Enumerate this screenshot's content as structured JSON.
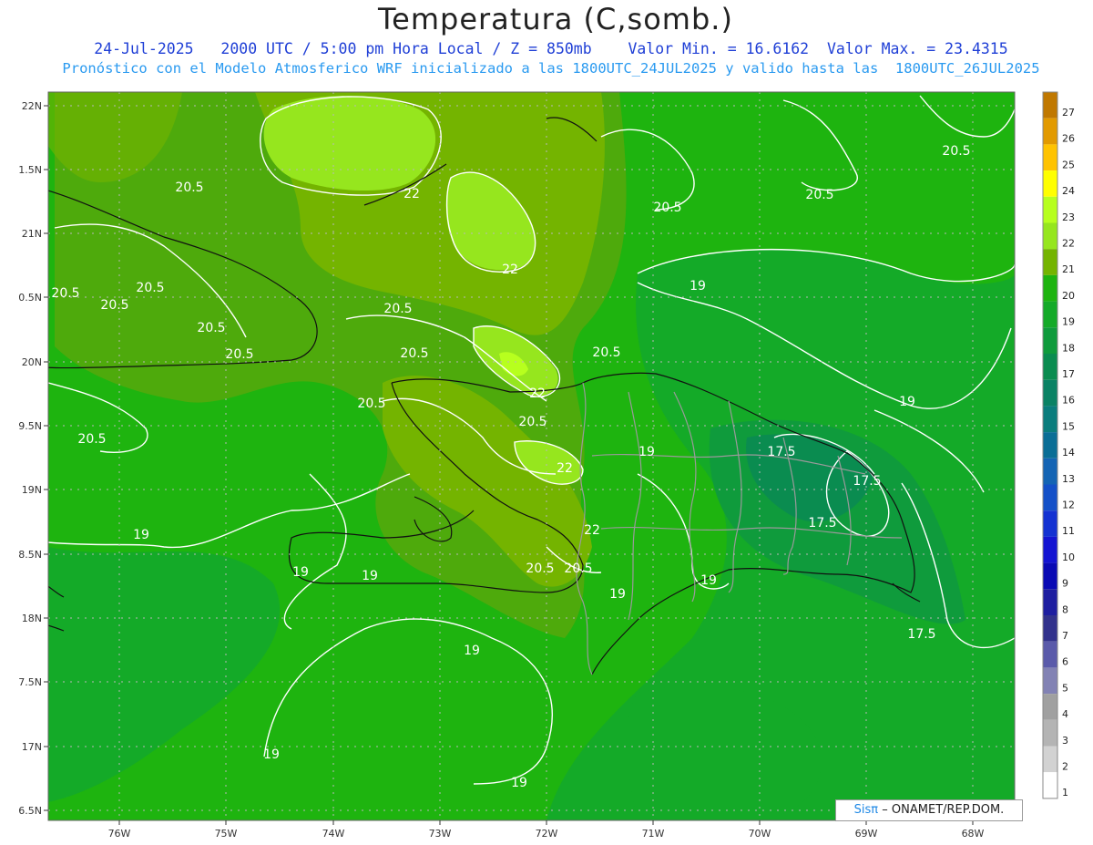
{
  "header": {
    "title": "Temperatura (C,somb.)",
    "date": "24-Jul-2025",
    "time_info": "2000 UTC / 5:00 pm Hora Local / Z = 850mb",
    "min_label": "Valor Min. = 16.6162",
    "max_label": "Valor Max. = 23.4315",
    "model_line": "Pronóstico con el Modelo Atmosferico WRF inicializado a las 1800UTC_24JUL2025 y valido hasta las  1800UTC_26JUL2025"
  },
  "axes": {
    "lon_labels": [
      "76W",
      "75W",
      "74W",
      "73W",
      "72W",
      "71W",
      "70W",
      "69W",
      "68W"
    ],
    "lat_labels": [
      "22N",
      "1.5N",
      "21N",
      "0.5N",
      "20N",
      "9.5N",
      "19N",
      "8.5N",
      "18N",
      "7.5N",
      "17N",
      "6.5N"
    ]
  },
  "contour_labels": [
    {
      "text": "20.5",
      "pos": [
        208,
        210
      ]
    },
    {
      "text": "22",
      "pos": [
        452,
        217
      ]
    },
    {
      "text": "22",
      "pos": [
        560,
        300
      ]
    },
    {
      "text": "20.5",
      "pos": [
        1050,
        170
      ]
    },
    {
      "text": "20.5",
      "pos": [
        900,
        218
      ]
    },
    {
      "text": "20.5",
      "pos": [
        733,
        232
      ]
    },
    {
      "text": "20.5",
      "pos": [
        72,
        326
      ]
    },
    {
      "text": "20.5",
      "pos": [
        165,
        320
      ]
    },
    {
      "text": "20.5",
      "pos": [
        126,
        339
      ]
    },
    {
      "text": "20.5",
      "pos": [
        437,
        343
      ]
    },
    {
      "text": "19",
      "pos": [
        766,
        318
      ]
    },
    {
      "text": "20.5",
      "pos": [
        232,
        364
      ]
    },
    {
      "text": "20.5",
      "pos": [
        263,
        393
      ]
    },
    {
      "text": "20.5",
      "pos": [
        455,
        392
      ]
    },
    {
      "text": "20.5",
      "pos": [
        666,
        391
      ]
    },
    {
      "text": "22",
      "pos": [
        590,
        436
      ]
    },
    {
      "text": "19",
      "pos": [
        996,
        445
      ]
    },
    {
      "text": "20.5",
      "pos": [
        408,
        447
      ]
    },
    {
      "text": "20.5",
      "pos": [
        585,
        467
      ]
    },
    {
      "text": "20.5",
      "pos": [
        101,
        486
      ]
    },
    {
      "text": "17.5",
      "pos": [
        858,
        500
      ]
    },
    {
      "text": "19",
      "pos": [
        710,
        500
      ]
    },
    {
      "text": "22",
      "pos": [
        620,
        518
      ]
    },
    {
      "text": "17.5",
      "pos": [
        952,
        532
      ]
    },
    {
      "text": "17.5",
      "pos": [
        903,
        578
      ]
    },
    {
      "text": "22",
      "pos": [
        650,
        586
      ]
    },
    {
      "text": "19",
      "pos": [
        155,
        591
      ]
    },
    {
      "text": "19",
      "pos": [
        330,
        632
      ]
    },
    {
      "text": "19",
      "pos": [
        406,
        636
      ]
    },
    {
      "text": "20.5",
      "pos": [
        593,
        628
      ]
    },
    {
      "text": "20.5",
      "pos": [
        635,
        628
      ]
    },
    {
      "text": "19",
      "pos": [
        778,
        641
      ]
    },
    {
      "text": "19",
      "pos": [
        678,
        656
      ]
    },
    {
      "text": "17.5",
      "pos": [
        1012,
        700
      ]
    },
    {
      "text": "19",
      "pos": [
        518,
        718
      ]
    },
    {
      "text": "19",
      "pos": [
        298,
        832
      ]
    },
    {
      "text": "19",
      "pos": [
        570,
        863
      ]
    }
  ],
  "colorbar": {
    "labels": [
      "27",
      "26",
      "25",
      "24",
      "23",
      "22",
      "21",
      "20",
      "19",
      "18",
      "17",
      "16",
      "15",
      "14",
      "13",
      "12",
      "11",
      "10",
      "9",
      "8",
      "7",
      "6",
      "5",
      "4",
      "3",
      "2",
      "1"
    ],
    "colors": [
      "#c07800",
      "#e29a00",
      "#ffc300",
      "#ffff00",
      "#b7ff1e",
      "#96e61e",
      "#74b400",
      "#1eb40f",
      "#14aa28",
      "#0f9b3c",
      "#0a8c50",
      "#0a8264",
      "#0a7d7d",
      "#0a6e96",
      "#1464b4",
      "#1450c8",
      "#1432d2",
      "#1414d2",
      "#0a0ab4",
      "#1e1ea0",
      "#32328c",
      "#5a5aaa",
      "#8282b4",
      "#a0a0a0",
      "#b4b4b4",
      "#d2d2d2",
      "#ffffff"
    ]
  },
  "credit": {
    "sis": "Sisπ",
    "rest": "– ONAMET/REP.DOM."
  }
}
